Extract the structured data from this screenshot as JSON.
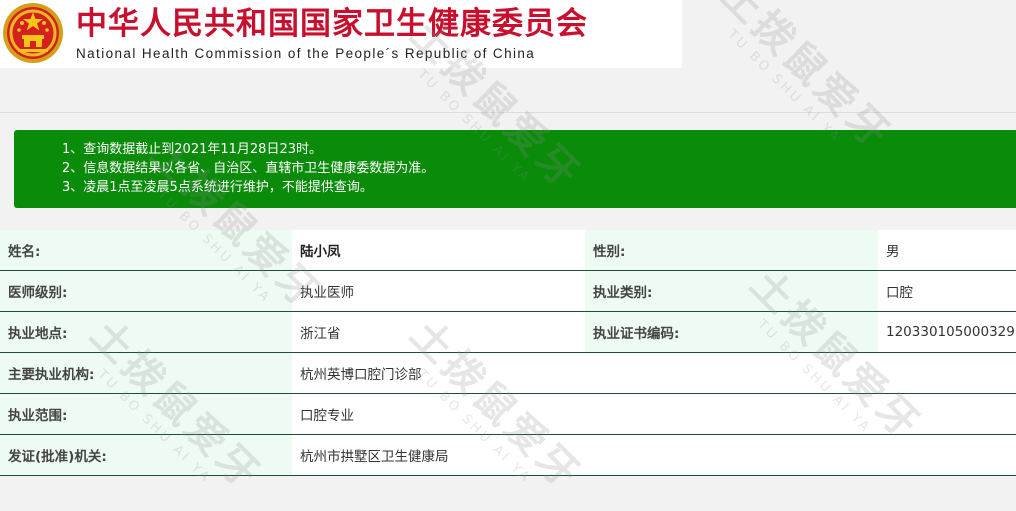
{
  "header": {
    "title_cn": "中华人民共和国国家卫生健康委员会",
    "title_en": "National Health Commission of the People´s Republic of China",
    "emblem_icon": "national-emblem-icon"
  },
  "notice": {
    "lines": [
      "1、查询数据截止到2021年11月28日23时。",
      "2、信息数据结果以各省、自治区、直辖市卫生健康委数据为准。",
      "3、凌晨1点至凌晨5点系统进行维护，不能提供查询。"
    ],
    "background": "#0a8b0a"
  },
  "info": {
    "name_label": "姓名:",
    "name_value": "陆小凤",
    "gender_label": "性别:",
    "gender_value": "男",
    "level_label": "医师级别:",
    "level_value": "执业医师",
    "category_label": "执业类别:",
    "category_value": "口腔",
    "location_label": "执业地点:",
    "location_value": "浙江省",
    "cert_label": "执业证书编码:",
    "cert_value": "120330105000329",
    "institution_label": "主要执业机构:",
    "institution_value": "杭州英博口腔门诊部",
    "scope_label": "执业范围:",
    "scope_value": "口腔专业",
    "issuer_label": "发证(批准)机关:",
    "issuer_value": "杭州市拱墅区卫生健康局"
  },
  "watermark": {
    "big": "土拨鼠爱牙",
    "small": "TU BO SHU    AI YA"
  },
  "colors": {
    "title_red": "#c8102e",
    "label_bg": "#eefbf3",
    "row_border": "#1e4d3a"
  }
}
